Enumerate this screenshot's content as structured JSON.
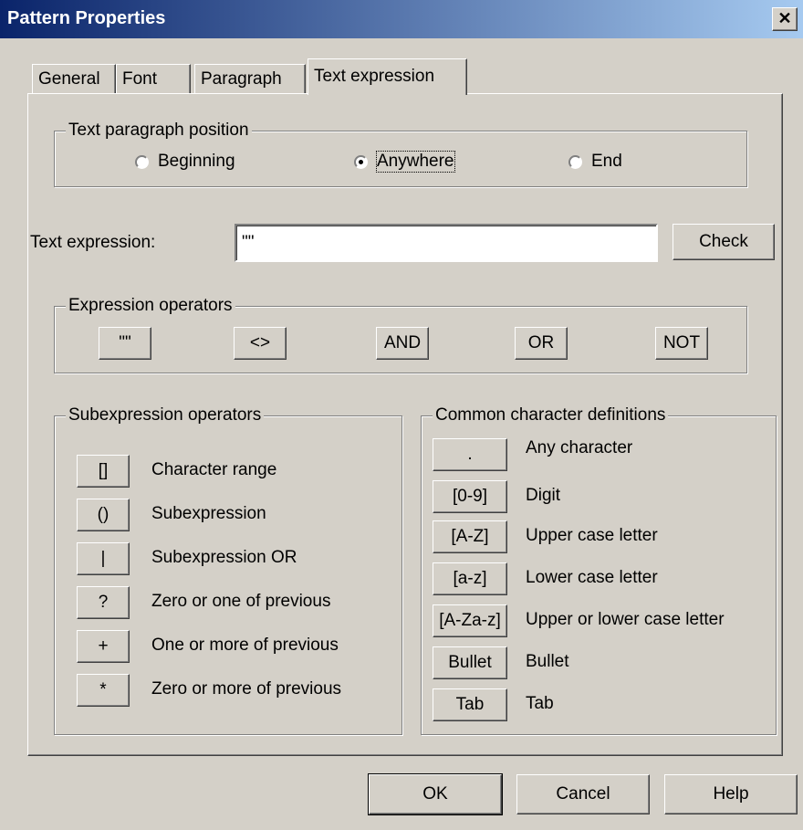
{
  "window": {
    "title": "Pattern Properties",
    "close_glyph": "✕"
  },
  "tabs": [
    {
      "label": "General"
    },
    {
      "label": "Font"
    },
    {
      "label": "Paragraph"
    },
    {
      "label": "Text expression",
      "active": true
    }
  ],
  "position_group": {
    "legend": "Text paragraph position",
    "options": [
      {
        "label": "Beginning",
        "selected": false
      },
      {
        "label": "Anywhere",
        "selected": true
      },
      {
        "label": "End",
        "selected": false
      }
    ]
  },
  "text_expression": {
    "label": "Text expression:",
    "value": "\"\"",
    "check_label": "Check"
  },
  "expression_operators": {
    "legend": "Expression operators",
    "buttons": [
      "\"\"",
      "<>",
      "AND",
      "OR",
      "NOT"
    ]
  },
  "subexpression_operators": {
    "legend": "Subexpression operators",
    "items": [
      {
        "button": "[]",
        "desc": "Character range"
      },
      {
        "button": "()",
        "desc": "Subexpression"
      },
      {
        "button": "|",
        "desc": "Subexpression OR"
      },
      {
        "button": "?",
        "desc": "Zero or one of previous"
      },
      {
        "button": "+",
        "desc": "One or more of previous"
      },
      {
        "button": "*",
        "desc": "Zero or more of previous"
      }
    ]
  },
  "common_definitions": {
    "legend": "Common character definitions",
    "items": [
      {
        "button": ".",
        "desc": "Any character"
      },
      {
        "button": "[0-9]",
        "desc": "Digit"
      },
      {
        "button": "[A-Z]",
        "desc": "Upper case letter"
      },
      {
        "button": "[a-z]",
        "desc": "Lower case letter"
      },
      {
        "button": "[A-Za-z]",
        "desc": "Upper or lower case letter"
      },
      {
        "button": "Bullet",
        "desc": "Bullet"
      },
      {
        "button": "Tab",
        "desc": "Tab"
      }
    ]
  },
  "footer": {
    "ok": "OK",
    "cancel": "Cancel",
    "help": "Help"
  }
}
